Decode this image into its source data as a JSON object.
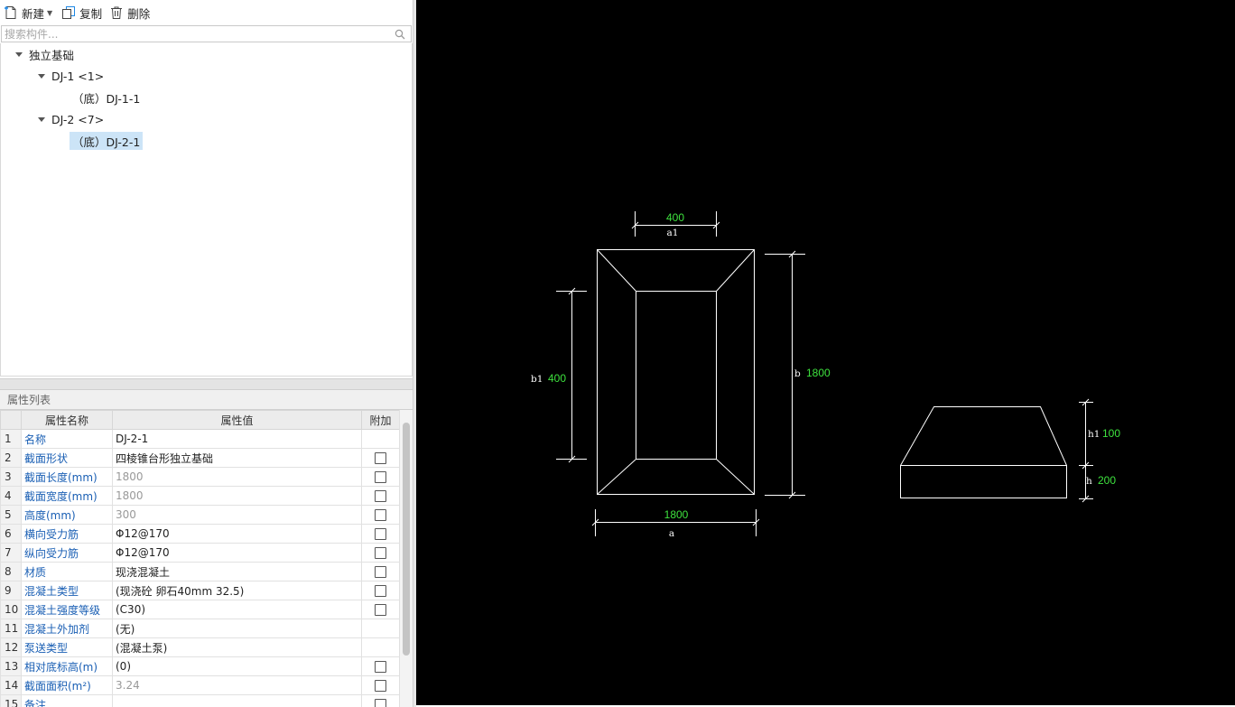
{
  "toolbar": {
    "new_label": "新建",
    "copy_label": "复制",
    "delete_label": "删除"
  },
  "search": {
    "placeholder": "搜索构件..."
  },
  "tree": {
    "root": "独立基础",
    "nodes": [
      {
        "label": "DJ-1 <1>",
        "child": "（底）DJ-1-1"
      },
      {
        "label": "DJ-2 <7>",
        "child": "（底）DJ-2-1"
      }
    ]
  },
  "props": {
    "title": "属性列表",
    "headers": [
      "属性名称",
      "属性值",
      "附加"
    ],
    "rows": [
      {
        "num": "1",
        "name": "名称",
        "value": "DJ-2-1",
        "gray": false,
        "check": false
      },
      {
        "num": "2",
        "name": "截面形状",
        "value": "四棱锥台形独立基础",
        "gray": false,
        "check": true
      },
      {
        "num": "3",
        "name": "截面长度(mm)",
        "value": "1800",
        "gray": true,
        "check": true
      },
      {
        "num": "4",
        "name": "截面宽度(mm)",
        "value": "1800",
        "gray": true,
        "check": true
      },
      {
        "num": "5",
        "name": "高度(mm)",
        "value": "300",
        "gray": true,
        "check": true
      },
      {
        "num": "6",
        "name": "横向受力筋",
        "value": "Φ12@170",
        "gray": false,
        "check": true
      },
      {
        "num": "7",
        "name": "纵向受力筋",
        "value": "Φ12@170",
        "gray": false,
        "check": true
      },
      {
        "num": "8",
        "name": "材质",
        "value": "现浇混凝土",
        "gray": false,
        "check": true
      },
      {
        "num": "9",
        "name": "混凝土类型",
        "value": "(现浇砼 卵石40mm 32.5)",
        "gray": false,
        "check": true
      },
      {
        "num": "10",
        "name": "混凝土强度等级",
        "value": "(C30)",
        "gray": false,
        "check": true
      },
      {
        "num": "11",
        "name": "混凝土外加剂",
        "value": "(无)",
        "gray": false,
        "check": false
      },
      {
        "num": "12",
        "name": "泵送类型",
        "value": "(混凝土泵)",
        "gray": false,
        "check": false
      },
      {
        "num": "13",
        "name": "相对底标高(m)",
        "value": "(0)",
        "gray": false,
        "check": true
      },
      {
        "num": "14",
        "name": "截面面积(m²)",
        "value": "3.24",
        "gray": true,
        "check": true
      },
      {
        "num": "15",
        "name": "备注",
        "value": "",
        "gray": false,
        "check": true
      }
    ]
  },
  "drawing": {
    "plan": {
      "a1_value": "400",
      "a1_label": "a1",
      "b1_label": "b1",
      "b1_value": "400",
      "b_label": "b",
      "b_value": "1800",
      "a_value": "1800",
      "a_label": "a"
    },
    "section": {
      "h1_label": "h1",
      "h1_value": "100",
      "h_label": "h",
      "h_value": "200"
    },
    "colors": {
      "dim_value": "#3ee23e",
      "line": "#ffffff",
      "background": "#000000"
    }
  }
}
